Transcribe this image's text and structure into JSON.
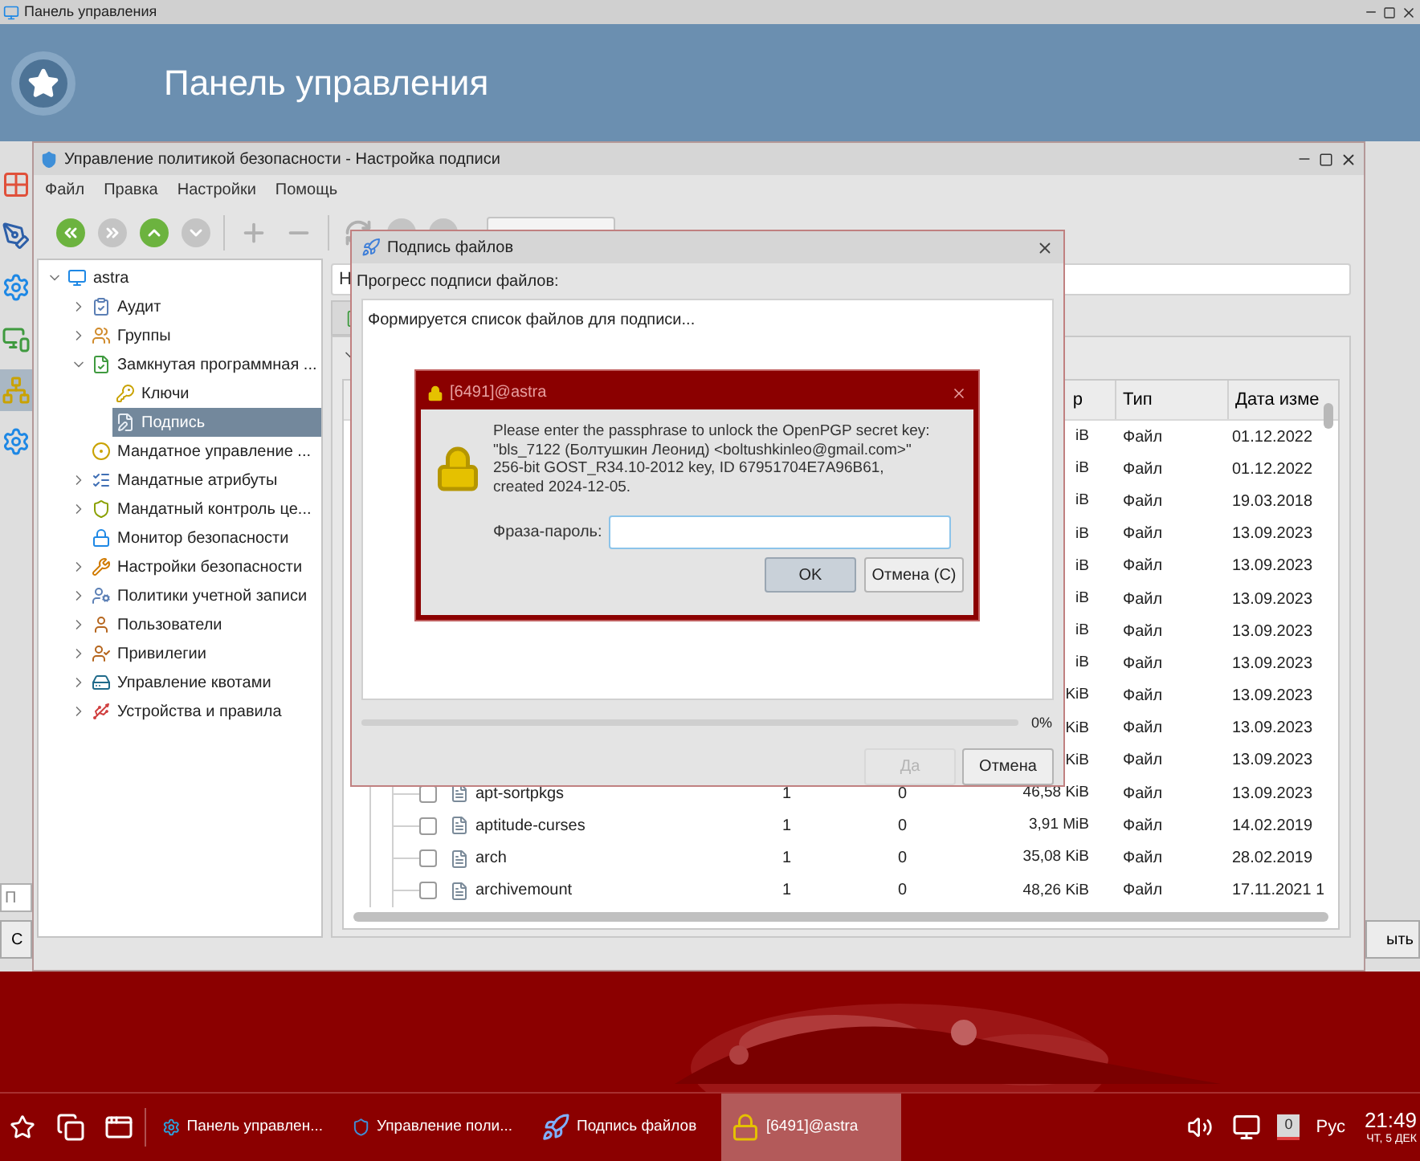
{
  "control_panel": {
    "title": "Панель управления",
    "header": "Панель управления",
    "sidebar": [
      {
        "kind": "grid",
        "selected": false
      },
      {
        "kind": "pen",
        "selected": false
      },
      {
        "kind": "gear",
        "selected": false
      },
      {
        "kind": "screens",
        "selected": false
      },
      {
        "kind": "network",
        "selected": true
      },
      {
        "kind": "gear",
        "selected": false
      }
    ],
    "search": {
      "placeholder": "П"
    },
    "left_button": "С",
    "right_button": "ыть"
  },
  "policy_window": {
    "title": "Управление политикой безопасности - Настройка подписи",
    "menu": [
      "Файл",
      "Правка",
      "Настройки",
      "Помощь"
    ],
    "toolbar": [
      {
        "kind": "back",
        "disabled": false
      },
      {
        "kind": "forward",
        "disabled": true
      },
      {
        "kind": "up",
        "disabled": false
      },
      {
        "kind": "down",
        "disabled": true
      },
      {
        "kind": "add",
        "disabled": true
      },
      {
        "kind": "remove",
        "disabled": true
      },
      {
        "kind": "refresh",
        "disabled": true
      },
      {
        "kind": "dot",
        "disabled": true
      },
      {
        "kind": "dot",
        "disabled": true
      }
    ],
    "tree": [
      {
        "label": "astra",
        "kind": "monitor",
        "expanded": true,
        "selected": false,
        "children": [
          {
            "label": "Аудит",
            "kind": "clipboard",
            "expanded": false,
            "selected": false
          },
          {
            "label": "Группы",
            "kind": "users",
            "expanded": false,
            "selected": false
          },
          {
            "label": "Замкнутая программная ...",
            "kind": "filecheck",
            "expanded": true,
            "selected": false,
            "children": [
              {
                "label": "Ключи",
                "kind": "key",
                "selected": false
              },
              {
                "label": "Подпись",
                "kind": "filepen",
                "selected": true
              }
            ]
          },
          {
            "label": "Мандатное управление ...",
            "kind": "circle",
            "selected": false
          },
          {
            "label": "Мандатные атрибуты",
            "kind": "list",
            "expanded": false,
            "selected": false
          },
          {
            "label": "Мандатный контроль це...",
            "kind": "shield",
            "expanded": false,
            "selected": false
          },
          {
            "label": "Монитор безопасности",
            "kind": "lock",
            "selected": false
          },
          {
            "label": "Настройки безопасности",
            "kind": "wrench",
            "expanded": false,
            "selected": false
          },
          {
            "label": "Политики учетной записи",
            "kind": "usercog",
            "expanded": false,
            "selected": false
          },
          {
            "label": "Пользователи",
            "kind": "user",
            "expanded": false,
            "selected": false
          },
          {
            "label": "Привилегии",
            "kind": "usercheck",
            "expanded": false,
            "selected": false
          },
          {
            "label": "Управление квотами",
            "kind": "drive",
            "expanded": false,
            "selected": false
          },
          {
            "label": "Устройства и правила",
            "kind": "usb",
            "expanded": false,
            "selected": false
          }
        ]
      }
    ],
    "path_field": {
      "value": "Н"
    },
    "table": {
      "columns": [
        {
          "label": "р"
        },
        {
          "label": "Тип"
        },
        {
          "label": "Дата изме"
        }
      ],
      "rows": [
        {
          "size": "iB",
          "type": "Файл",
          "date": "01.12.2022"
        },
        {
          "size": "iB",
          "type": "Файл",
          "date": "01.12.2022"
        },
        {
          "size": "iB",
          "type": "Файл",
          "date": "19.03.2018"
        },
        {
          "size": "iB",
          "type": "Файл",
          "date": "13.09.2023"
        },
        {
          "size": "iB",
          "type": "Файл",
          "date": "13.09.2023"
        },
        {
          "size": "iB",
          "type": "Файл",
          "date": "13.09.2023"
        },
        {
          "size": "iB",
          "type": "Файл",
          "date": "13.09.2023"
        },
        {
          "size": "iB",
          "type": "Файл",
          "date": "13.09.2023"
        },
        {
          "size": "KiB",
          "type": "Файл",
          "date": "13.09.2023"
        },
        {
          "size": "KiB",
          "type": "Файл",
          "date": "13.09.2023"
        },
        {
          "size": "KiB",
          "type": "Файл",
          "date": "13.09.2023"
        },
        {
          "name": "apt-sortpkgs",
          "checked": false,
          "c2": "1",
          "c3": "0",
          "size": "46,58 KiB",
          "type": "Файл",
          "date": "13.09.2023"
        },
        {
          "name": "aptitude-curses",
          "checked": false,
          "c2": "1",
          "c3": "0",
          "size": "3,91 MiB",
          "type": "Файл",
          "date": "14.02.2019"
        },
        {
          "name": "arch",
          "checked": false,
          "c2": "1",
          "c3": "0",
          "size": "35,08 KiB",
          "type": "Файл",
          "date": "28.02.2019"
        },
        {
          "name": "archivemount",
          "checked": false,
          "c2": "1",
          "c3": "0",
          "size": "48,26 KiB",
          "type": "Файл",
          "date": "17.11.2021 1"
        }
      ]
    }
  },
  "sign_dialog": {
    "title": "Подпись файлов",
    "label": "Прогресс подписи файлов:",
    "log": "Формируется список файлов для подписи...",
    "progress": {
      "level": 0,
      "reading": "0%"
    },
    "buttons": [
      {
        "label": "Да",
        "disabled": true
      },
      {
        "label": "Отмена",
        "disabled": false
      }
    ]
  },
  "passphrase_dialog": {
    "title": "[6491]@astra",
    "message_lines": [
      "Please enter the passphrase to unlock the OpenPGP secret key:",
      "\"bls_7122 (Болтушкин Леонид) <boltushkinleo@gmail.com>\"",
      "256-bit GOST_R34.10-2012 key, ID 67951704E7A96B61,",
      "created 2024-12-05."
    ],
    "field_label": "Фраза-пароль:",
    "buttons": [
      {
        "label": "OK",
        "selected": true
      },
      {
        "label": "Отмена (С)",
        "selected": false
      }
    ]
  },
  "taskbar": {
    "tasks": [
      {
        "label": "Панель управлен...",
        "kind": "gear",
        "selected": false
      },
      {
        "label": "Управление поли...",
        "kind": "shield",
        "selected": false
      },
      {
        "label": "Подпись файлов",
        "kind": "rocket",
        "selected": false
      },
      {
        "label": "[6491]@astra",
        "kind": "lock",
        "selected": true
      }
    ],
    "badge": "0",
    "language": "Рус",
    "time": "21:49",
    "date": "ЧТ, 5 ДЕК"
  }
}
